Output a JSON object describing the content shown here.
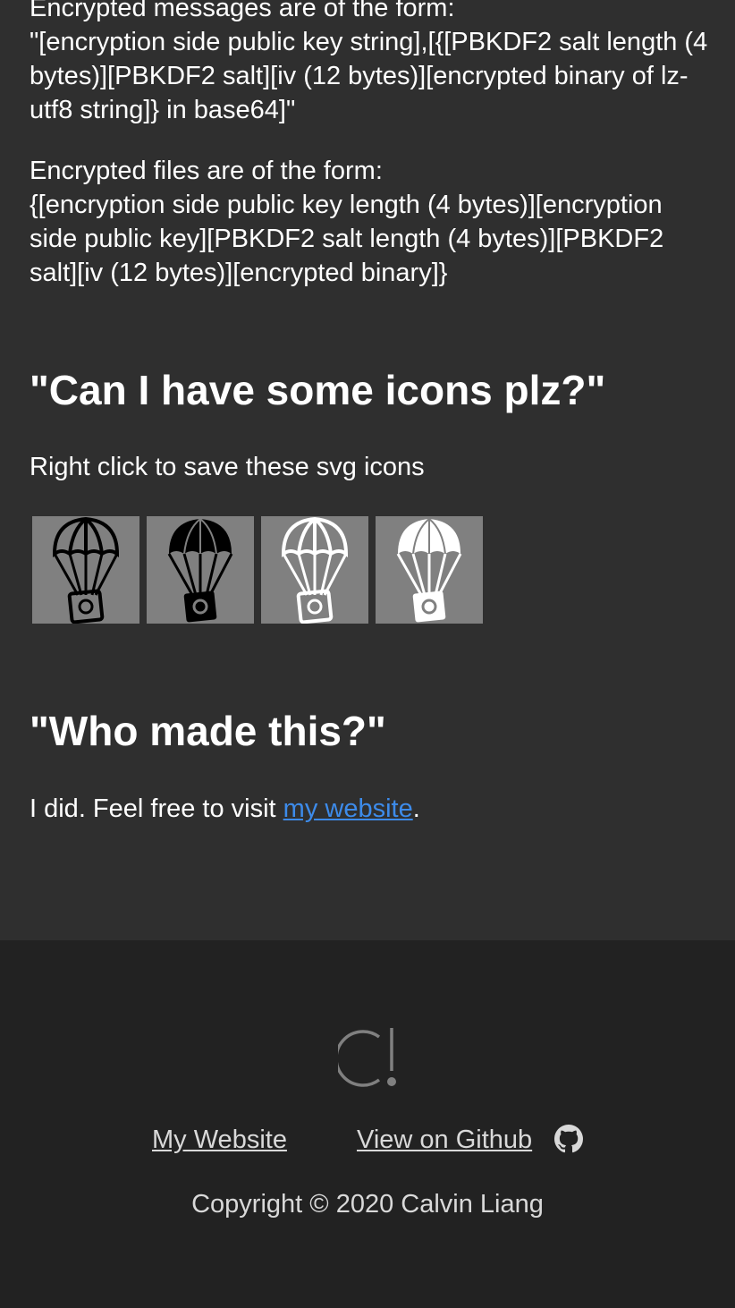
{
  "format": {
    "messages_paragraph": "Encrypted messages are of the form:\n\"[encryption side public key string],[{[PBKDF2 salt length (4 bytes)][PBKDF2 salt][iv (12 bytes)][encrypted binary of lz-utf8 string]} in base64]\"",
    "files_paragraph": "Encrypted files are of the form:\n{[encryption side public key length (4 bytes)][encryption side public key][PBKDF2 salt length (4 bytes)][PBKDF2 salt][iv (12 bytes)][encrypted binary]}"
  },
  "icons_section": {
    "heading": "\"Can I have some icons plz?\"",
    "description": "Right click to save these svg icons",
    "icons": [
      "parachute-black-outline-icon",
      "parachute-black-solid-icon",
      "parachute-white-outline-icon",
      "parachute-white-solid-icon"
    ]
  },
  "who_section": {
    "heading": "\"Who made this?\"",
    "text_before": "I did. Feel free to visit ",
    "link_text": "my website",
    "text_after": "."
  },
  "footer": {
    "logo": "chat-exclamation-logo-icon",
    "my_website_link": "My Website",
    "github_link": "View on Github",
    "github_icon": "github-icon",
    "copyright": "Copyright © 2020 Calvin Liang"
  },
  "colors": {
    "main_bg": "#2f2f2f",
    "footer_bg": "#222222",
    "tile_bg": "#808080",
    "link_blue": "#3d8bea",
    "footer_text": "#d9d9d9"
  }
}
